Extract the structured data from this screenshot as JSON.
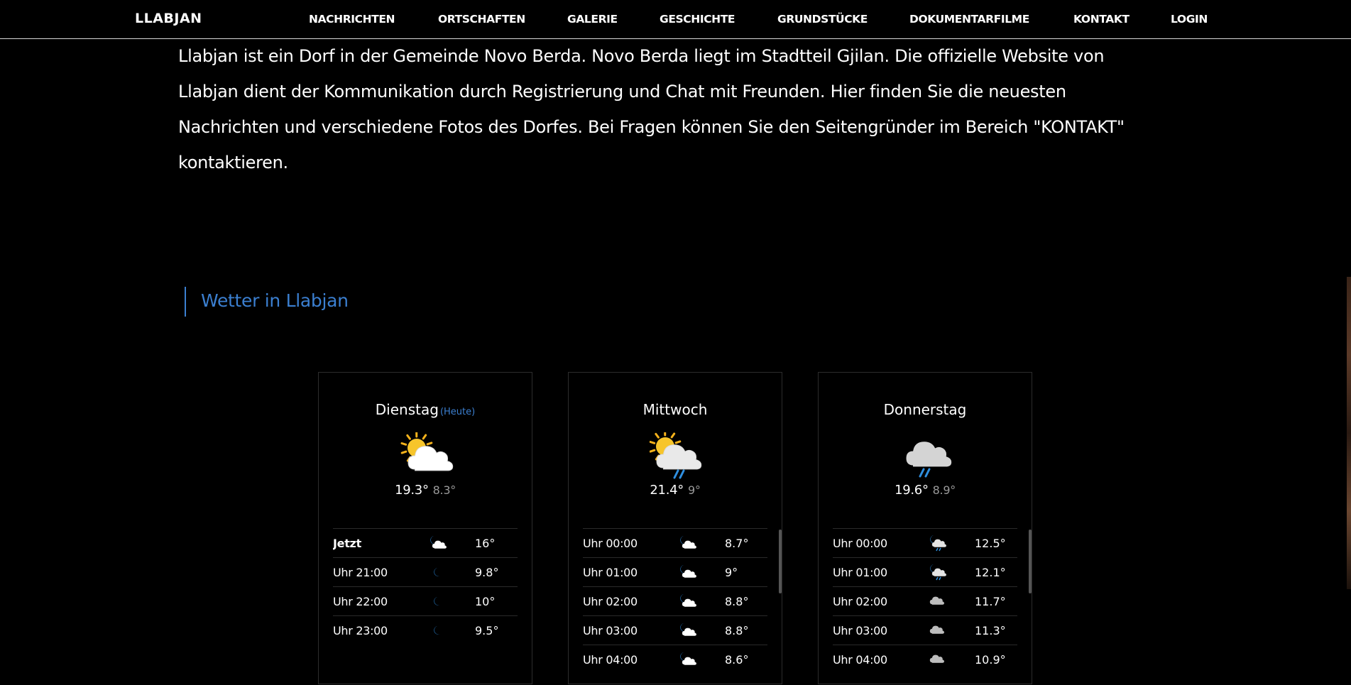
{
  "brand": "LLABJAN",
  "nav": [
    "NACHRICHTEN",
    "ORTSCHAFTEN",
    "GALERIE",
    "GESCHICHTE",
    "GRUNDSTÜCKE",
    "DOKUMENTARFILME",
    "KONTAKT",
    "LOGIN"
  ],
  "intro": [
    "Llabjan ist ein Dorf in der Gemeinde Novo Berda. Novo Berda liegt im Stadtteil Gjilan. Die offizielle Website von",
    "Llabjan dient der Kommunikation durch Registrierung und Chat mit Freunden. Hier finden Sie die neuesten",
    "Nachrichten und verschiedene Fotos des Dorfes. Bei Fragen können Sie den Seitengründer im Bereich \"KONTAKT\"",
    "kontaktieren."
  ],
  "weather_title": "Wetter in Llabjan",
  "colors": {
    "accent": "#3b7fd0",
    "background": "#000000",
    "text": "#ffffff",
    "muted": "#9a9a9a"
  },
  "days": [
    {
      "name": "Dienstag",
      "badge": "(Heute)",
      "icon": "sun-cloud-icon",
      "max": "19.3°",
      "min": "8.3°",
      "hours": [
        {
          "time": "Jetzt",
          "icon": "moon-cloud-icon",
          "temp": "16°"
        },
        {
          "time": "Uhr 21:00",
          "icon": "moon-icon",
          "temp": "9.8°"
        },
        {
          "time": "Uhr 22:00",
          "icon": "moon-icon",
          "temp": "10°"
        },
        {
          "time": "Uhr 23:00",
          "icon": "moon-icon",
          "temp": "9.5°"
        }
      ]
    },
    {
      "name": "Mittwoch",
      "badge": "",
      "icon": "sun-cloud-rain-icon",
      "max": "21.4°",
      "min": "9°",
      "hours": [
        {
          "time": "Uhr 00:00",
          "icon": "moon-cloud-icon",
          "temp": "8.7°"
        },
        {
          "time": "Uhr 01:00",
          "icon": "moon-cloud-icon",
          "temp": "9°"
        },
        {
          "time": "Uhr 02:00",
          "icon": "moon-cloud-icon",
          "temp": "8.8°"
        },
        {
          "time": "Uhr 03:00",
          "icon": "moon-cloud-icon",
          "temp": "8.8°"
        },
        {
          "time": "Uhr 04:00",
          "icon": "moon-cloud-icon",
          "temp": "8.6°"
        }
      ]
    },
    {
      "name": "Donnerstag",
      "badge": "",
      "icon": "cloud-rain-icon",
      "max": "19.6°",
      "min": "8.9°",
      "hours": [
        {
          "time": "Uhr 00:00",
          "icon": "moon-cloud-rain-icon",
          "temp": "12.5°"
        },
        {
          "time": "Uhr 01:00",
          "icon": "moon-cloud-rain-icon",
          "temp": "12.1°"
        },
        {
          "time": "Uhr 02:00",
          "icon": "cloud-icon",
          "temp": "11.7°"
        },
        {
          "time": "Uhr 03:00",
          "icon": "cloud-icon",
          "temp": "11.3°"
        },
        {
          "time": "Uhr 04:00",
          "icon": "cloud-icon",
          "temp": "10.9°"
        }
      ]
    }
  ]
}
